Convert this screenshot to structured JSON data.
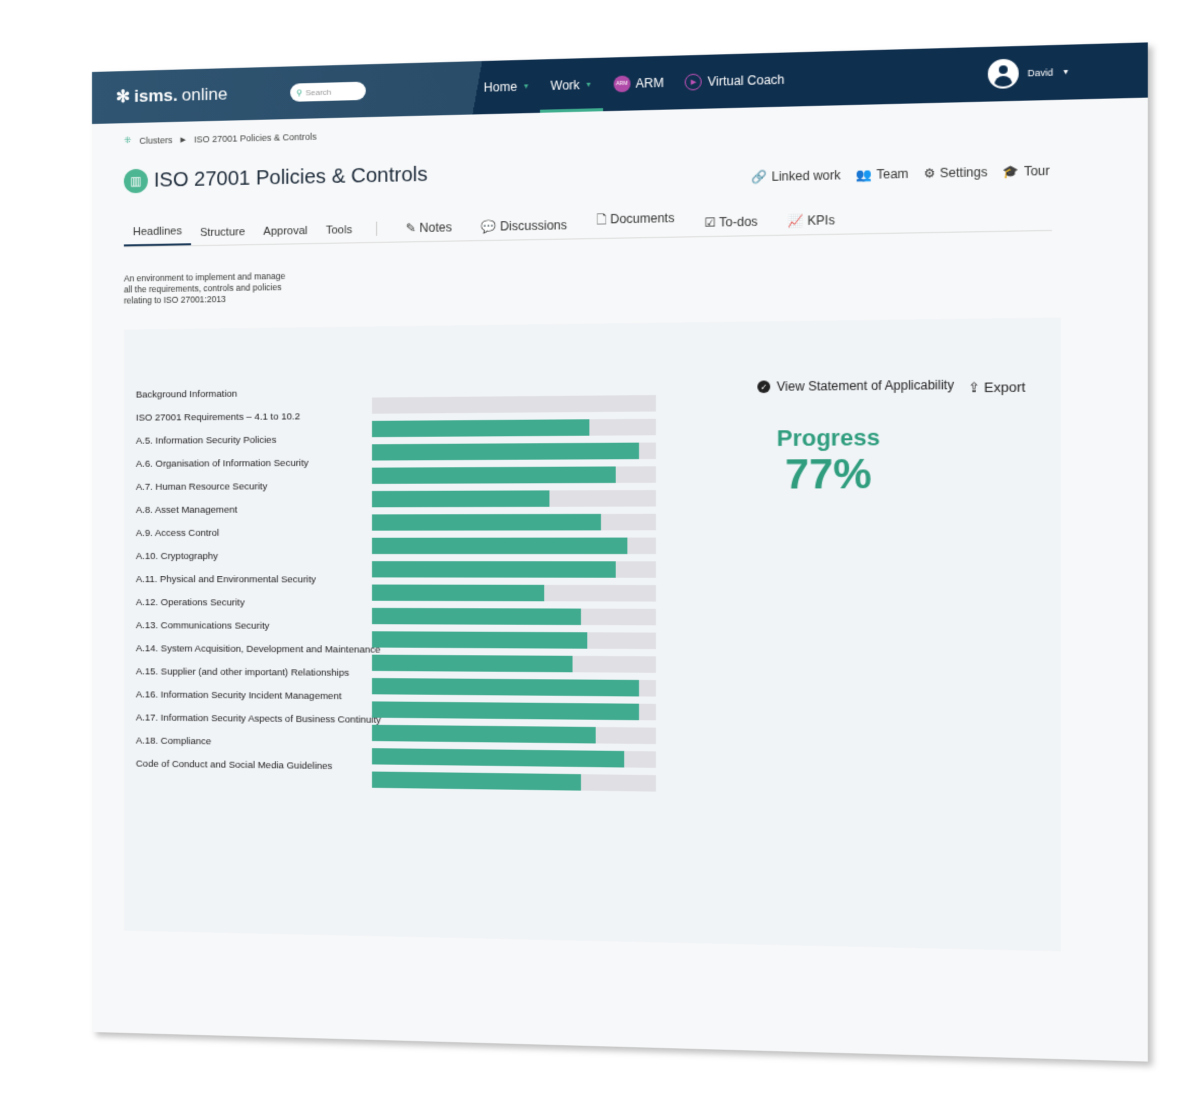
{
  "header": {
    "logo": {
      "bold": "isms.",
      "light": "online"
    },
    "search_placeholder": "Search",
    "nav": [
      {
        "label": "Home"
      },
      {
        "label": "Work",
        "active": true
      },
      {
        "label": "ARM",
        "badge": "ARM"
      },
      {
        "label": "Virtual Coach"
      }
    ],
    "user": "David"
  },
  "breadcrumb": [
    "Clusters",
    "ISO 27001 Policies & Controls"
  ],
  "page_title": "ISO 27001 Policies & Controls",
  "actions": [
    {
      "label": "Linked work",
      "icon": "link-icon"
    },
    {
      "label": "Team",
      "icon": "team-icon"
    },
    {
      "label": "Settings",
      "icon": "gear-icon"
    },
    {
      "label": "Tour",
      "icon": "graduation-cap-icon"
    }
  ],
  "tabs": [
    "Headlines",
    "Structure",
    "Approval",
    "Tools"
  ],
  "tabs2": [
    {
      "label": "Notes",
      "icon": "edit-icon"
    },
    {
      "label": "Discussions",
      "icon": "chat-icon"
    },
    {
      "label": "Documents",
      "icon": "document-icon"
    },
    {
      "label": "To-dos",
      "icon": "clipboard-check-icon"
    },
    {
      "label": "KPIs",
      "icon": "chart-icon"
    }
  ],
  "description": "An environment to implement and manage all the requirements, controls and policies relating to ISO 27001:2013",
  "colors": {
    "accent": "#40ab8f",
    "navy": "#0f2f4e",
    "track": "#e0e0e4"
  },
  "chart_data": {
    "type": "bar",
    "orientation": "horizontal",
    "header": "Background Information",
    "xlim": [
      0,
      100
    ],
    "categories": [
      "ISO 27001 Requirements – 4.1 to 10.2",
      "A.5. Information Security Policies",
      "A.6. Organisation of Information Security",
      "A.7. Human Resource Security",
      "A.8. Asset Management",
      "A.9. Access Control",
      "A.10. Cryptography",
      "A.11. Physical and Environmental Security",
      "A.12. Operations Security",
      "A.13. Communications Security",
      "A.14. System Acquisition, Development and Maintenance",
      "A.15. Supplier (and other important) Relationships",
      "A.16. Information Security Incident Management",
      "A.17. Information Security Aspects of Business Continuity",
      "A.18. Compliance",
      "Code of Conduct and Social Media Guidelines"
    ],
    "values": [
      0,
      77,
      94,
      86,
      63,
      81,
      90,
      86,
      61,
      74,
      76,
      71,
      94,
      94,
      79,
      89,
      74
    ]
  },
  "soa_label": "View Statement of Applicability",
  "export_label": "Export",
  "progress": {
    "label": "Progress",
    "value": "77%"
  }
}
